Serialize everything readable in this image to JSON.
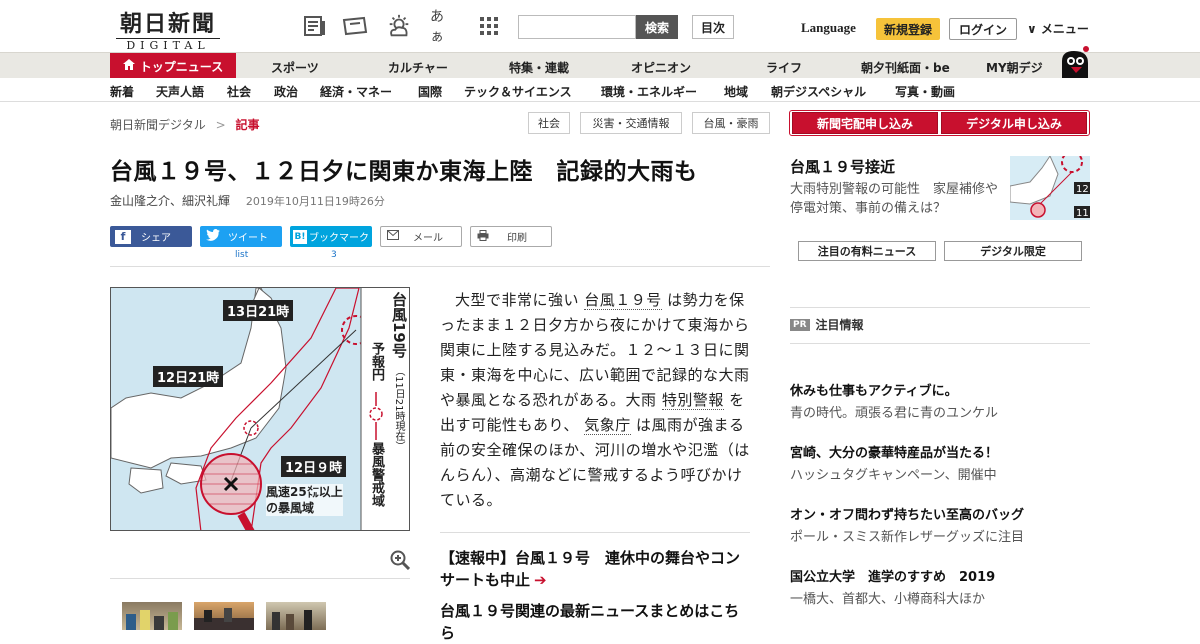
{
  "header": {
    "logo_main": "朝日新聞",
    "logo_sub": "DIGITAL",
    "search_placeholder": "",
    "search_button": "検索",
    "contents_button": "目次",
    "language": "Language",
    "register": "新規登録",
    "login": "ログイン",
    "menu": "∨ メニュー",
    "font_icon_text": "あぁ"
  },
  "nav_primary": [
    "トップニュース",
    "スポーツ",
    "カルチャー",
    "特集・連載",
    "オピニオン",
    "ライフ",
    "朝夕刊紙面・be",
    "MY朝デジ"
  ],
  "nav_secondary": [
    "新着",
    "天声人語",
    "社会",
    "政治",
    "経済・マネー",
    "国際",
    "テック＆サイエンス",
    "環境・エネルギー",
    "地域",
    "朝デジスペシャル",
    "写真・動画"
  ],
  "breadcrumb": {
    "home": "朝日新聞デジタル",
    "sep": ">",
    "current": "記事"
  },
  "tags": [
    "社会",
    "災害・交通情報",
    "台風・豪雨"
  ],
  "article": {
    "title": "台風１９号、１２日夕に関東か東海上陸　記録的大雨も",
    "authors": "金山隆之介、細沢礼輝",
    "datetime": "2019年10月11日19時26分",
    "share": {
      "facebook": "シェア",
      "twitter": "ツイート",
      "twitter_sub": "list",
      "hatena": "ブックマーク",
      "hatena_count": "3",
      "mail": "メール",
      "print": "印刷"
    },
    "body": [
      "大型で非常に強い",
      "台風１９号",
      "は勢力を保ったまま１２日夕方から夜にかけて東海から関東に上陸する見込みだ。１２～１３日に関東・東海を中心に、広い範囲で記録的な大雨や暴風となる恐れがある。大雨",
      "特別警報",
      "を出す可能性もあり、",
      "気象庁",
      "は風雨が強まる前の安全確保のほか、河川の増水や氾濫（はんらん）、高潮などに警戒するよう呼びかけている。"
    ],
    "related1": "【速報中】台風１９号　連休中の舞台やコンサートも中止",
    "related2": "台風１９号関連の最新ニュースまとめはこちら"
  },
  "figure": {
    "label_13": "13日21時",
    "label_12_21": "12日21時",
    "label_12_9": "12日９時",
    "side_title": "台風19号",
    "side_note": "（11日21時現在）",
    "forecast": "予報円",
    "storm_zone": "暴風警戒域",
    "wind_note_1": "風速25㍍以上",
    "wind_note_2": "の暴風域"
  },
  "sidebar": {
    "btn_home": "新聞宅配申し込み",
    "btn_digital": "デジタル申し込み",
    "feature_title": "台風１９号接近",
    "feature_sub": "大雨特別警報の可能性　家屋補修や停電対策、事前の備えは？",
    "tab_paid": "注目の有料ニュース",
    "tab_digital": "デジタル限定",
    "pr_badge": "PR",
    "pr_title": "注目情報",
    "ads": [
      {
        "title": "休みも仕事もアクティブに。",
        "sub": "青の時代。頑張る君に青のユンケル"
      },
      {
        "title": "宮崎、大分の豪華特産品が当たる！",
        "sub": "ハッシュタグキャンペーン、開催中"
      },
      {
        "title": "オン・オフ問わず持ちたい至高のバッグ",
        "sub": "ポール・スミス新作レザーグッズに注目"
      },
      {
        "title": "国公立大学　進学のすすめ　2019",
        "sub": "一橋大、首都大、小樽商科大ほか"
      }
    ]
  },
  "colors": {
    "accent": "#c8102e",
    "nav_bg": "#e9e8e3",
    "twitter": "#1da1f2",
    "facebook": "#3b5998",
    "hatena": "#00a4de"
  }
}
